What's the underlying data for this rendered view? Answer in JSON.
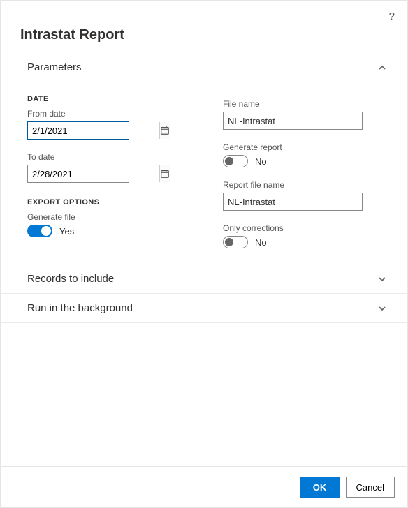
{
  "help_tooltip": "?",
  "title": "Intrastat Report",
  "sections": {
    "parameters": {
      "title": "Parameters",
      "expanded": true,
      "date_group": "DATE",
      "from_date_label": "From date",
      "from_date_value": "2/1/2021",
      "to_date_label": "To date",
      "to_date_value": "2/28/2021",
      "export_group": "EXPORT OPTIONS",
      "generate_file_label": "Generate file",
      "generate_file_on": true,
      "generate_file_text": "Yes",
      "file_name_label": "File name",
      "file_name_value": "NL-Intrastat",
      "generate_report_label": "Generate report",
      "generate_report_on": false,
      "generate_report_text": "No",
      "report_file_name_label": "Report file name",
      "report_file_name_value": "NL-Intrastat",
      "only_corrections_label": "Only corrections",
      "only_corrections_on": false,
      "only_corrections_text": "No"
    },
    "records": {
      "title": "Records to include",
      "expanded": false
    },
    "background": {
      "title": "Run in the background",
      "expanded": false
    }
  },
  "buttons": {
    "ok": "OK",
    "cancel": "Cancel"
  }
}
